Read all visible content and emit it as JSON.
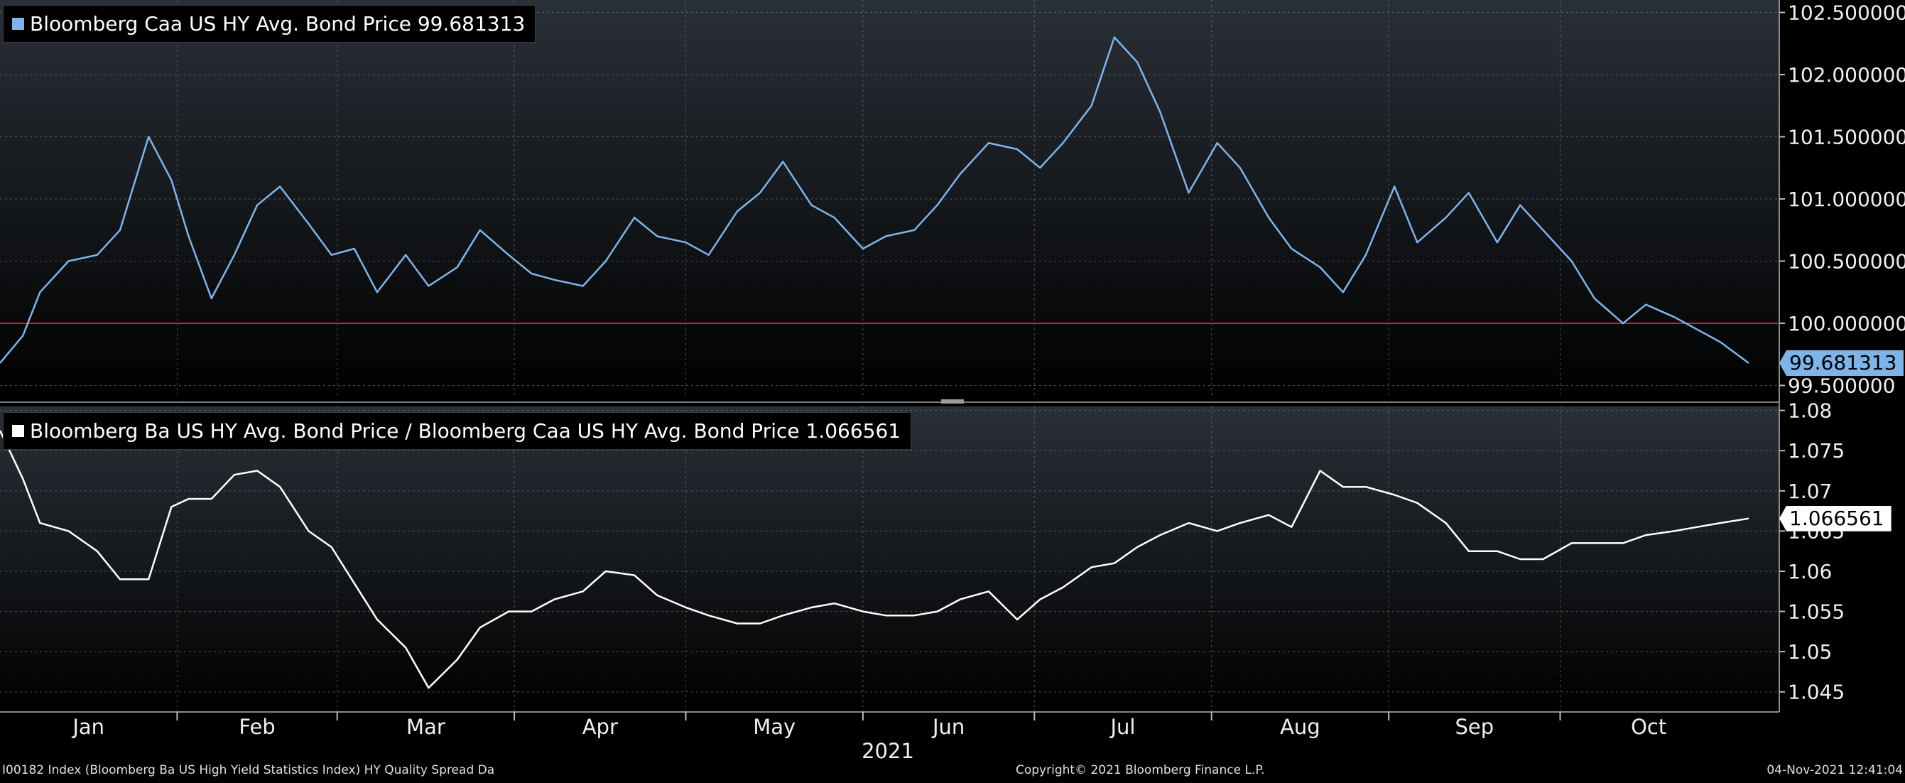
{
  "chart_data": [
    {
      "type": "line",
      "legend": "Bloomberg Caa US HY Avg. Bond Price 99.681313",
      "series": [
        {
          "name": "Bloomberg Caa US HY Avg. Bond Price",
          "color": "#7fb4ea",
          "x": [
            "2021-01-01",
            "2021-01-05",
            "2021-01-08",
            "2021-01-13",
            "2021-01-18",
            "2021-01-22",
            "2021-01-27",
            "2021-01-31",
            "2021-02-03",
            "2021-02-07",
            "2021-02-11",
            "2021-02-15",
            "2021-02-19",
            "2021-02-24",
            "2021-02-28",
            "2021-03-04",
            "2021-03-08",
            "2021-03-13",
            "2021-03-17",
            "2021-03-22",
            "2021-03-26",
            "2021-03-31",
            "2021-04-04",
            "2021-04-08",
            "2021-04-13",
            "2021-04-17",
            "2021-04-22",
            "2021-04-26",
            "2021-05-01",
            "2021-05-05",
            "2021-05-10",
            "2021-05-14",
            "2021-05-18",
            "2021-05-23",
            "2021-05-27",
            "2021-06-01",
            "2021-06-05",
            "2021-06-10",
            "2021-06-14",
            "2021-06-18",
            "2021-06-23",
            "2021-06-28",
            "2021-07-02",
            "2021-07-06",
            "2021-07-11",
            "2021-07-15",
            "2021-07-19",
            "2021-07-23",
            "2021-07-28",
            "2021-08-02",
            "2021-08-06",
            "2021-08-11",
            "2021-08-15",
            "2021-08-20",
            "2021-08-24",
            "2021-08-28",
            "2021-09-02",
            "2021-09-06",
            "2021-09-11",
            "2021-09-15",
            "2021-09-20",
            "2021-09-24",
            "2021-09-28",
            "2021-10-03",
            "2021-10-07",
            "2021-10-12",
            "2021-10-16",
            "2021-10-21",
            "2021-10-25",
            "2021-10-29",
            "2021-11-03"
          ],
          "y": [
            99.68,
            99.9,
            100.25,
            100.5,
            100.55,
            100.75,
            101.5,
            101.15,
            100.7,
            100.2,
            100.55,
            100.95,
            101.1,
            100.8,
            100.55,
            100.6,
            100.25,
            100.55,
            100.3,
            100.45,
            100.75,
            100.55,
            100.4,
            100.35,
            100.3,
            100.5,
            100.85,
            100.7,
            100.65,
            100.55,
            100.9,
            101.05,
            101.3,
            100.95,
            100.85,
            100.6,
            100.7,
            100.75,
            100.95,
            101.2,
            101.45,
            101.4,
            101.25,
            101.45,
            101.75,
            102.3,
            102.1,
            101.7,
            101.05,
            101.45,
            101.25,
            100.85,
            100.6,
            100.45,
            100.25,
            100.55,
            101.1,
            100.65,
            100.85,
            101.05,
            100.65,
            100.95,
            100.75,
            100.5,
            100.2,
            100.0,
            100.15,
            100.05,
            99.95,
            99.85,
            99.68
          ]
        }
      ],
      "reference_line": {
        "y": 100.0,
        "color": "#d02020"
      },
      "ylim": [
        99.4,
        102.6
      ],
      "yticks": [
        {
          "v": 102.5,
          "label": "102.500000"
        },
        {
          "v": 102.0,
          "label": "102.000000"
        },
        {
          "v": 101.5,
          "label": "101.500000"
        },
        {
          "v": 101.0,
          "label": "101.000000"
        },
        {
          "v": 100.5,
          "label": "100.500000"
        },
        {
          "v": 100.0,
          "label": "100.000000"
        },
        {
          "v": 99.5,
          "label": "99.500000"
        }
      ],
      "last_value": "99.681313",
      "grid": true
    },
    {
      "type": "line",
      "legend": "Bloomberg Ba US HY Avg. Bond Price / Bloomberg Caa US HY Avg. Bond Price 1.066561",
      "series": [
        {
          "name": "Bloomberg Ba US HY Avg. Bond Price / Bloomberg Caa US HY Avg. Bond Price",
          "color": "#ffffff",
          "x": [
            "2021-01-01",
            "2021-01-05",
            "2021-01-08",
            "2021-01-13",
            "2021-01-18",
            "2021-01-22",
            "2021-01-27",
            "2021-01-31",
            "2021-02-03",
            "2021-02-07",
            "2021-02-11",
            "2021-02-15",
            "2021-02-19",
            "2021-02-24",
            "2021-02-28",
            "2021-03-04",
            "2021-03-08",
            "2021-03-13",
            "2021-03-17",
            "2021-03-22",
            "2021-03-26",
            "2021-03-31",
            "2021-04-04",
            "2021-04-08",
            "2021-04-13",
            "2021-04-17",
            "2021-04-22",
            "2021-04-26",
            "2021-05-01",
            "2021-05-05",
            "2021-05-10",
            "2021-05-14",
            "2021-05-18",
            "2021-05-23",
            "2021-05-27",
            "2021-06-01",
            "2021-06-05",
            "2021-06-10",
            "2021-06-14",
            "2021-06-18",
            "2021-06-23",
            "2021-06-28",
            "2021-07-02",
            "2021-07-06",
            "2021-07-11",
            "2021-07-15",
            "2021-07-19",
            "2021-07-23",
            "2021-07-28",
            "2021-08-02",
            "2021-08-06",
            "2021-08-11",
            "2021-08-15",
            "2021-08-20",
            "2021-08-24",
            "2021-08-28",
            "2021-09-02",
            "2021-09-06",
            "2021-09-11",
            "2021-09-15",
            "2021-09-20",
            "2021-09-24",
            "2021-09-28",
            "2021-10-03",
            "2021-10-07",
            "2021-10-12",
            "2021-10-16",
            "2021-10-21",
            "2021-10-25",
            "2021-10-29",
            "2021-11-03"
          ],
          "y": [
            1.0775,
            1.0715,
            1.066,
            1.065,
            1.0625,
            1.059,
            1.059,
            1.068,
            1.069,
            1.069,
            1.072,
            1.0725,
            1.0705,
            1.065,
            1.063,
            1.0585,
            1.054,
            1.0505,
            1.0455,
            1.049,
            1.053,
            1.055,
            1.055,
            1.0565,
            1.0575,
            1.06,
            1.0595,
            1.057,
            1.0555,
            1.0545,
            1.0535,
            1.0535,
            1.0545,
            1.0555,
            1.056,
            1.055,
            1.0545,
            1.0545,
            1.055,
            1.0565,
            1.0575,
            1.054,
            1.0565,
            1.058,
            1.0605,
            1.061,
            1.063,
            1.0645,
            1.066,
            1.065,
            1.066,
            1.067,
            1.0655,
            1.0725,
            1.0705,
            1.0705,
            1.0695,
            1.0685,
            1.066,
            1.0625,
            1.0625,
            1.0615,
            1.0615,
            1.0635,
            1.0635,
            1.0635,
            1.0645,
            1.065,
            1.0655,
            1.066,
            1.066561
          ]
        }
      ],
      "ylim": [
        1.0425,
        1.0805
      ],
      "yticks": [
        {
          "v": 1.08,
          "label": "1.08"
        },
        {
          "v": 1.075,
          "label": "1.075"
        },
        {
          "v": 1.07,
          "label": "1.07"
        },
        {
          "v": 1.065,
          "label": "1.065"
        },
        {
          "v": 1.06,
          "label": "1.06"
        },
        {
          "v": 1.055,
          "label": "1.055"
        },
        {
          "v": 1.05,
          "label": "1.05"
        },
        {
          "v": 1.045,
          "label": "1.045"
        }
      ],
      "last_value": "1.066561",
      "grid": true
    }
  ],
  "x_axis": {
    "range": [
      "2021-01-01",
      "2021-11-03"
    ],
    "months": [
      {
        "label": "Jan",
        "start": "2021-01-01",
        "end": "2021-02-01"
      },
      {
        "label": "Feb",
        "start": "2021-02-01",
        "end": "2021-03-01"
      },
      {
        "label": "Mar",
        "start": "2021-03-01",
        "end": "2021-04-01"
      },
      {
        "label": "Apr",
        "start": "2021-04-01",
        "end": "2021-05-01"
      },
      {
        "label": "May",
        "start": "2021-05-01",
        "end": "2021-06-01"
      },
      {
        "label": "Jun",
        "start": "2021-06-01",
        "end": "2021-07-01"
      },
      {
        "label": "Jul",
        "start": "2021-07-01",
        "end": "2021-08-01"
      },
      {
        "label": "Aug",
        "start": "2021-08-01",
        "end": "2021-09-01"
      },
      {
        "label": "Sep",
        "start": "2021-09-01",
        "end": "2021-10-01"
      },
      {
        "label": "Oct",
        "start": "2021-10-01",
        "end": "2021-11-01"
      }
    ],
    "year_label": "2021"
  },
  "footer": {
    "left": "I00182 Index (Bloomberg Ba US High Yield Statistics Index) HY Quality Spread  Da",
    "center": "Copyright© 2021 Bloomberg Finance L.P.",
    "right": "04-Nov-2021 12:41:04"
  }
}
